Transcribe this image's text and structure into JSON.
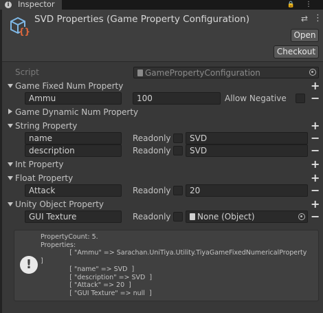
{
  "tab": {
    "label": "Inspector"
  },
  "header": {
    "title": "SVD Properties (Game Property Configuration)",
    "open_label": "Open",
    "checkout_label": "Checkout"
  },
  "script_row": {
    "label": "Script",
    "value": "GamePropertyConfiguration"
  },
  "fixed_num": {
    "label": "Game Fixed Num Property",
    "item_name": "Ammu",
    "item_value": "100",
    "allow_negative_label": "Allow Negative"
  },
  "dynamic_num": {
    "label": "Game Dynamic Num Property"
  },
  "string_prop": {
    "label": "String Property",
    "rows": [
      {
        "name": "name",
        "readonly_label": "Readonly",
        "value": "SVD"
      },
      {
        "name": "description",
        "readonly_label": "Readonly",
        "value": "SVD"
      }
    ]
  },
  "int_prop": {
    "label": "Int Property"
  },
  "float_prop": {
    "label": "Float Property",
    "rows": [
      {
        "name": "Attack",
        "readonly_label": "Readonly",
        "value": "20"
      }
    ]
  },
  "object_prop": {
    "label": "Unity Object Property",
    "rows": [
      {
        "name": "GUI Texture",
        "readonly_label": "Readonly",
        "value": "None (Object)"
      }
    ]
  },
  "help": {
    "text": "PropertyCount: 5.\nProperties:\n              [ \"Ammu\" => Sarachan.UniTiya.Utility.TiyaGameFixedNumericalProperty\n]\n              [ \"name\" => SVD  ]\n              [ \"description\" => SVD  ]\n              [ \"Attack\" => 20  ]\n              [ \"GUI Texture\" => null  ]"
  },
  "icons": {
    "plus": "+",
    "minus": "−",
    "warning": "!",
    "info": "i",
    "lock": "🔒",
    "menu": "⋮",
    "settings": "⇄",
    "kebab": "⋮"
  }
}
